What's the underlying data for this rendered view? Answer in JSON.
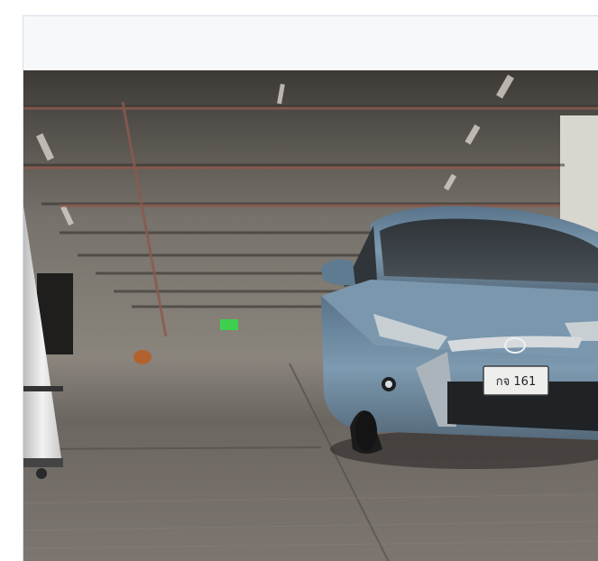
{
  "image": {
    "alt": "",
    "plate_text": "กจ 161"
  },
  "colors": {
    "page_background": "#ffffff",
    "frame_background": "#f6f8fa",
    "frame_border": "#d6dde6",
    "car_body": "#6f8fa3",
    "ceiling": "#5e5a55",
    "floor": "#6b6662",
    "pipe": "#8a5a4e"
  }
}
